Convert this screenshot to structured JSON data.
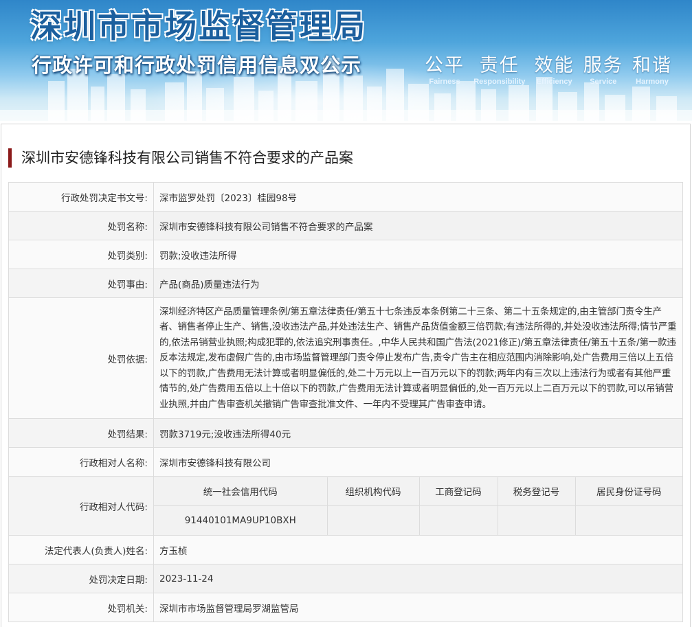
{
  "banner": {
    "title": "深圳市市场监督管理局",
    "subtitle": "行政许可和行政处罚信用信息双公示",
    "slogans": [
      {
        "cn": "公平",
        "en": "Fairness"
      },
      {
        "cn": "责任",
        "en": "Responsibility"
      },
      {
        "cn": "效能",
        "en": "Efficiency"
      },
      {
        "cn": "服务",
        "en": "Service"
      },
      {
        "cn": "和谐",
        "en": "Harmony"
      }
    ]
  },
  "case": {
    "title": "深圳市安德锋科技有限公司销售不符合要求的产品案"
  },
  "fields": {
    "doc_no": {
      "label": "行政处罚决定书文号:",
      "value": "深市监罗处罚〔2023〕桂园98号"
    },
    "name": {
      "label": "处罚名称:",
      "value": "深圳市安德锋科技有限公司销售不符合要求的产品案"
    },
    "category": {
      "label": "处罚类别:",
      "value": "罚款;没收违法所得"
    },
    "reason": {
      "label": "处罚事由:",
      "value": "产品(商品)质量违法行为"
    },
    "basis": {
      "label": "处罚依据:",
      "value": "深圳经济特区产品质量管理条例/第五章法律责任/第五十七条违反本条例第二十三条、第二十五条规定的,由主管部门责令生产者、销售者停止生产、销售,没收违法产品,并处违法生产、销售产品货值金额三倍罚款;有违法所得的,并处没收违法所得;情节严重的,依法吊销营业执照;构成犯罪的,依法追究刑事责任。,中华人民共和国广告法(2021修正)/第五章法律责任/第五十五条/第一款违反本法规定,发布虚假广告的,由市场监督管理部门责令停止发布广告,责令广告主在相应范围内消除影响,处广告费用三倍以上五倍以下的罚款,广告费用无法计算或者明显偏低的,处二十万元以上一百万元以下的罚款;两年内有三次以上违法行为或者有其他严重情节的,处广告费用五倍以上十倍以下的罚款,广告费用无法计算或者明显偏低的,处一百万元以上二百万元以下的罚款,可以吊销营业执照,并由广告审查机关撤销广告审查批准文件、一年内不受理其广告审查申请。"
    },
    "result": {
      "label": "处罚结果:",
      "value": "罚款3719元;没收违法所得40元"
    },
    "party_name": {
      "label": "行政相对人名称:",
      "value": "深圳市安德锋科技有限公司"
    },
    "party_code": {
      "label": "行政相对人代码:",
      "headers": [
        "统一社会信用代码",
        "组织机构代码",
        "工商登记码",
        "税务登记号",
        "居民身份证号码"
      ],
      "values": [
        "91440101MA9UP10BXH",
        "",
        "",
        "",
        ""
      ]
    },
    "legal_rep": {
      "label": "法定代表人(负责人)姓名:",
      "value": "方玉桢"
    },
    "date": {
      "label": "处罚决定日期:",
      "value": "2023-11-24"
    },
    "authority": {
      "label": "处罚机关:",
      "value": "深圳市市场监督管理局罗湖监管局"
    }
  },
  "colors": {
    "title_bar": "#8b1a1a",
    "banner_blue": "#2f86c9",
    "banner_title": "#1b5f9e"
  }
}
